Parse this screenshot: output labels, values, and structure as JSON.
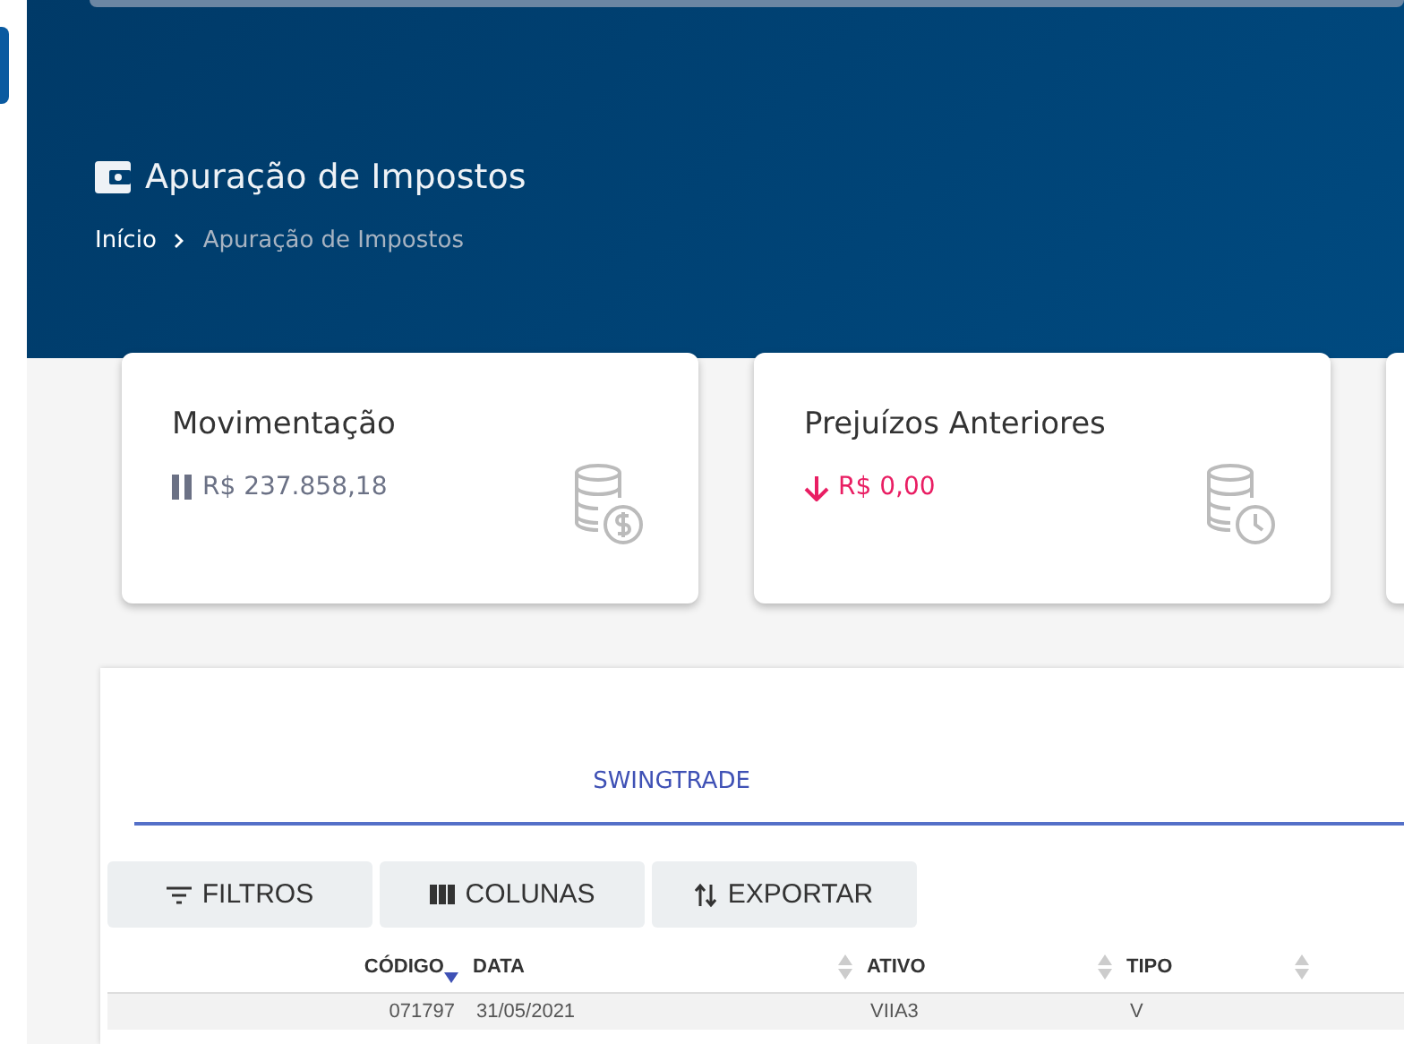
{
  "page_title": "Apuração de Impostos",
  "breadcrumb": [
    {
      "label": "Início",
      "selected": false
    },
    {
      "label": "Apuração de Impostos",
      "selected": true
    }
  ],
  "cards": [
    {
      "title": "Movimentação",
      "value": "R$ 237.858,18",
      "kind": "neutral"
    },
    {
      "title": "Prejuízos Anteriores",
      "value": "R$ 0,00",
      "kind": "negative"
    }
  ],
  "tabs": [
    {
      "label": "SWINGTRADE",
      "selected": true
    }
  ],
  "toolbar": [
    {
      "label": "FILTROS"
    },
    {
      "label": "COLUNAS"
    },
    {
      "label": "EXPORTAR"
    }
  ],
  "table": {
    "columns": [
      {
        "label": "CÓDIGO",
        "sorted": true
      },
      {
        "label": "DATA",
        "sorted": false
      },
      {
        "label": "ATIVO",
        "sorted": false
      },
      {
        "label": "TIPO",
        "sorted": false
      }
    ],
    "rows": [
      [
        "071797",
        "31/05/2021",
        "VIIA3",
        "V"
      ]
    ]
  }
}
